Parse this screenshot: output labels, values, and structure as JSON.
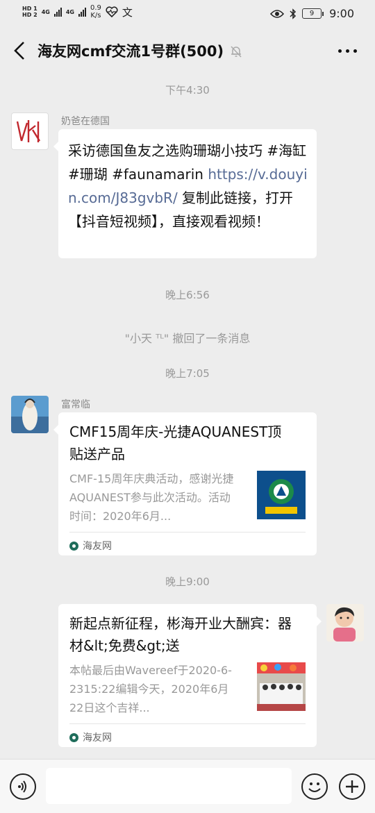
{
  "status": {
    "hd1": "HD 1",
    "hd2": "HD 2",
    "net1": "4G",
    "net2": "4G",
    "speed_value": "0.9",
    "speed_unit": "K/s",
    "battery": "9",
    "time": "9:00"
  },
  "header": {
    "title": "海友网cmf交流1号群(500)"
  },
  "chat": {
    "time1": "下午4:30",
    "msg1_sender": "奶爸在德国",
    "msg1_text": "采访德国鱼友之选购珊瑚小技巧 #海缸 #珊瑚 #faunamarin ",
    "msg1_link": "https://v.douyin.com/J83gvbR/",
    "msg1_tail": " 复制此链接，打开【抖音短视频】，直接观看视频！",
    "time2": "晚上6:56",
    "recall": "\"小天 ᵀᴸ\" 撤回了一条消息",
    "time3": "晚上7:05",
    "msg2_sender": "富常临",
    "card1_title": "CMF15周年庆-光捷AQUANEST顶贴送产品",
    "card1_desc": "CMF-15周年庆典活动，感谢光捷AQUANEST参与此次活动。活动时间：2020年6月...",
    "card1_source": "海友网",
    "time4": "晚上9:00",
    "card2_title": "新起点新征程，彬海开业大酬宾：器材&lt;免费&gt;送",
    "card2_desc": "本帖最后由Wavereef于2020-6-2315:22编辑今天，2020年6月22日这个吉祥...",
    "card2_source": "海友网"
  },
  "colors": {
    "background": "#ededed",
    "link": "#576b95",
    "meta_gray": "#999999"
  },
  "icons": {
    "back": "chevron-left-icon",
    "mute": "bell-off-icon",
    "more": "more-dots-icon",
    "voice": "voice-icon",
    "emoji": "emoji-icon",
    "plus": "plus-icon"
  }
}
